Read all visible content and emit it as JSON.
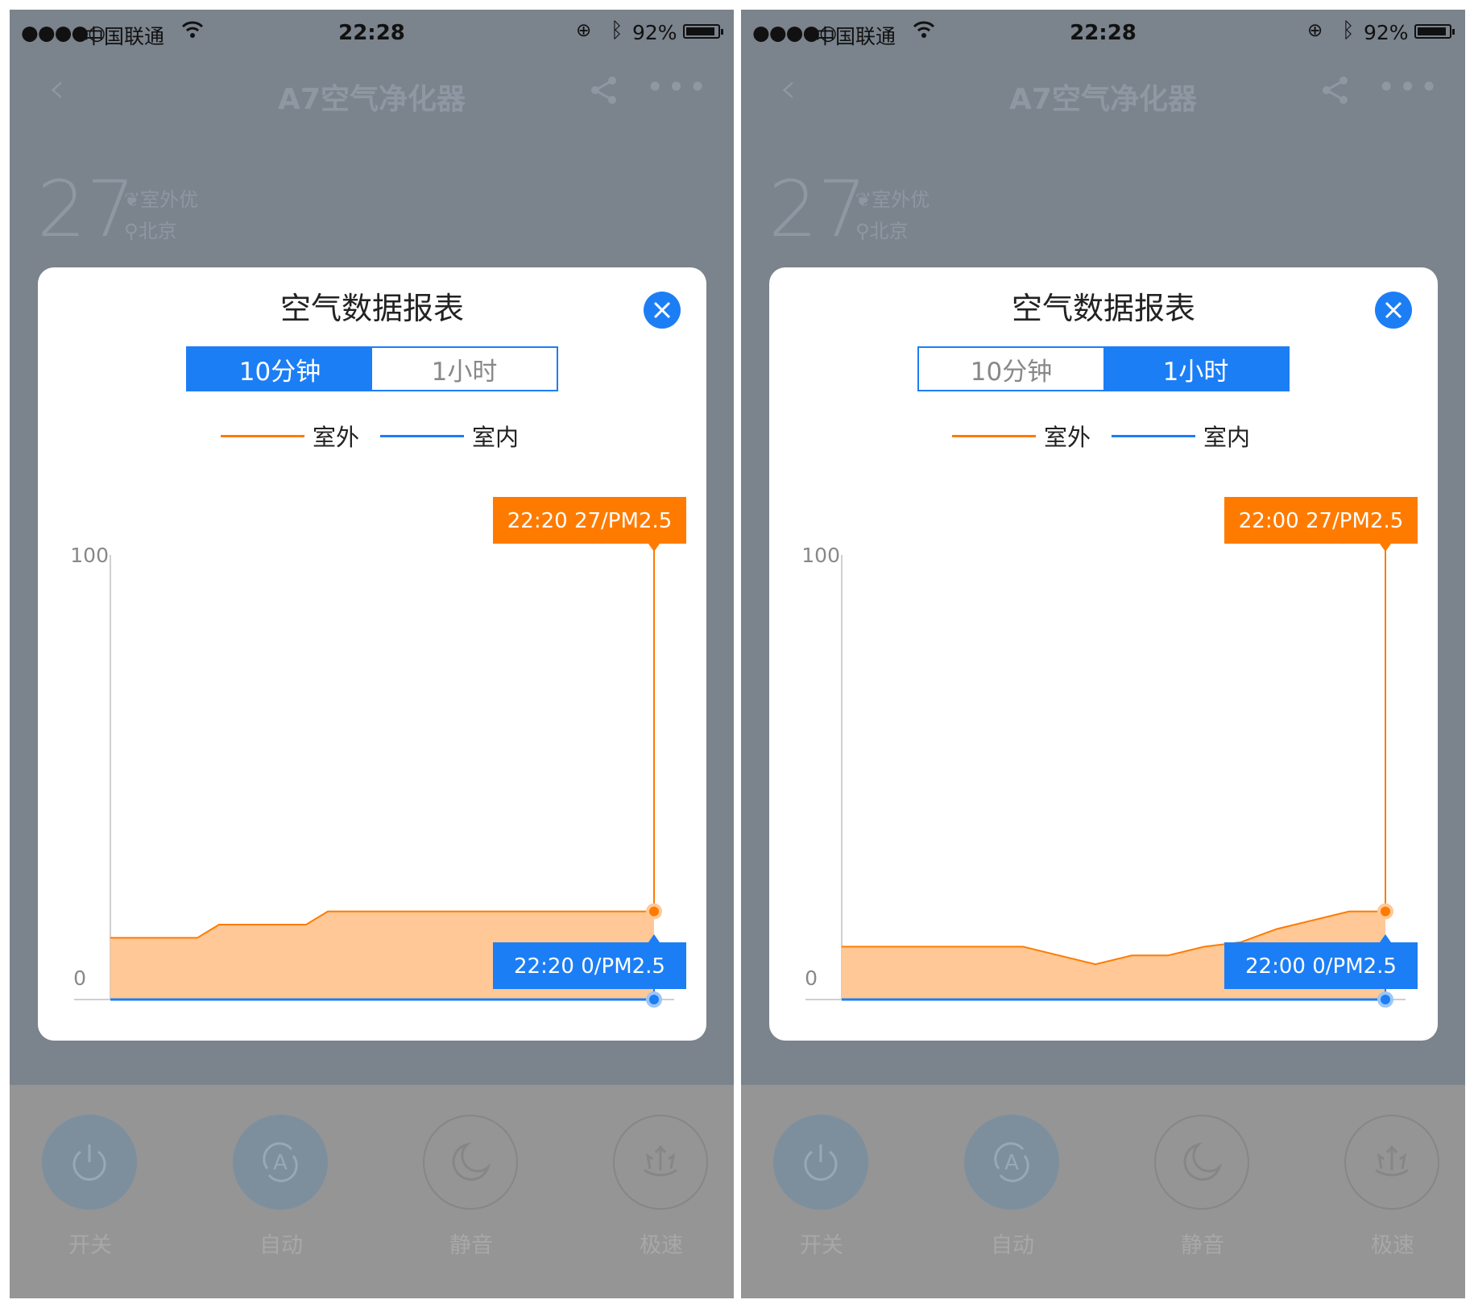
{
  "colors": {
    "outdoor": "#ff7b00",
    "outdoor_fill": "#ffc896",
    "indoor": "#1c7ef5",
    "overlay": "#7b838d"
  },
  "screens": [
    {
      "status": {
        "carrier": "中国联通",
        "time": "22:28",
        "battery": "92%"
      },
      "nav": {
        "title": "A7空气净化器"
      },
      "aqi": {
        "value": "27",
        "quality": "室外优",
        "city": "北京"
      },
      "modes": [
        {
          "label": "开关",
          "icon": "power-icon"
        },
        {
          "label": "自动",
          "icon": "auto-mode-icon"
        },
        {
          "label": "静音",
          "icon": "moon-icon"
        },
        {
          "label": "极速",
          "icon": "turbo-icon"
        }
      ],
      "modal": {
        "title": "空气数据报表",
        "tabs": [
          {
            "label": "10分钟",
            "active": true
          },
          {
            "label": "1小时",
            "active": false
          }
        ],
        "legend": [
          {
            "label": "室外",
            "color": "#ff7b00"
          },
          {
            "label": "室内",
            "color": "#1c7ef5"
          }
        ],
        "tooltip_outdoor": "22:20 27/PM2.5",
        "tooltip_indoor": "22:20 0/PM2.5"
      },
      "chart_data": {
        "type": "area",
        "y_tick_labels": [
          "100",
          "0"
        ],
        "ylim": [
          0,
          100
        ],
        "legend_position": "top-center",
        "grid": false,
        "x": [
          0,
          1,
          1.6,
          2,
          3,
          3.6,
          4,
          5,
          6,
          7,
          8,
          9,
          10
        ],
        "series": [
          {
            "name": "室外",
            "values": [
              14,
              14,
              14,
              17,
              17,
              17,
              20,
              20,
              20,
              20,
              20,
              20,
              20
            ]
          },
          {
            "name": "室内",
            "values": [
              0,
              0,
              0,
              0,
              0,
              0,
              0,
              0,
              0,
              0,
              0,
              0,
              0
            ]
          }
        ]
      }
    },
    {
      "status": {
        "carrier": "中国联通",
        "time": "22:28",
        "battery": "92%"
      },
      "nav": {
        "title": "A7空气净化器"
      },
      "aqi": {
        "value": "27",
        "quality": "室外优",
        "city": "北京"
      },
      "modes": [
        {
          "label": "开关",
          "icon": "power-icon"
        },
        {
          "label": "自动",
          "icon": "auto-mode-icon"
        },
        {
          "label": "静音",
          "icon": "moon-icon"
        },
        {
          "label": "极速",
          "icon": "turbo-icon"
        }
      ],
      "modal": {
        "title": "空气数据报表",
        "tabs": [
          {
            "label": "10分钟",
            "active": false
          },
          {
            "label": "1小时",
            "active": true
          }
        ],
        "legend": [
          {
            "label": "室外",
            "color": "#ff7b00"
          },
          {
            "label": "室内",
            "color": "#1c7ef5"
          }
        ],
        "tooltip_outdoor": "22:00 27/PM2.5",
        "tooltip_indoor": "22:00 0/PM2.5"
      },
      "chart_data": {
        "type": "area",
        "y_tick_labels": [
          "100",
          "0"
        ],
        "ylim": [
          0,
          100
        ],
        "legend_position": "top-center",
        "grid": false,
        "x": [
          0,
          1,
          2,
          3,
          4,
          5,
          6,
          7,
          8,
          9,
          10,
          11,
          12,
          13,
          14,
          15
        ],
        "series": [
          {
            "name": "室外",
            "values": [
              12,
              12,
              12,
              12,
              12,
              12,
              10,
              8,
              10,
              10,
              12,
              13,
              16,
              18,
              20,
              20
            ]
          },
          {
            "name": "室内",
            "values": [
              0,
              0,
              0,
              0,
              0,
              0,
              0,
              0,
              0,
              0,
              0,
              0,
              0,
              0,
              0,
              0
            ]
          }
        ]
      }
    }
  ]
}
